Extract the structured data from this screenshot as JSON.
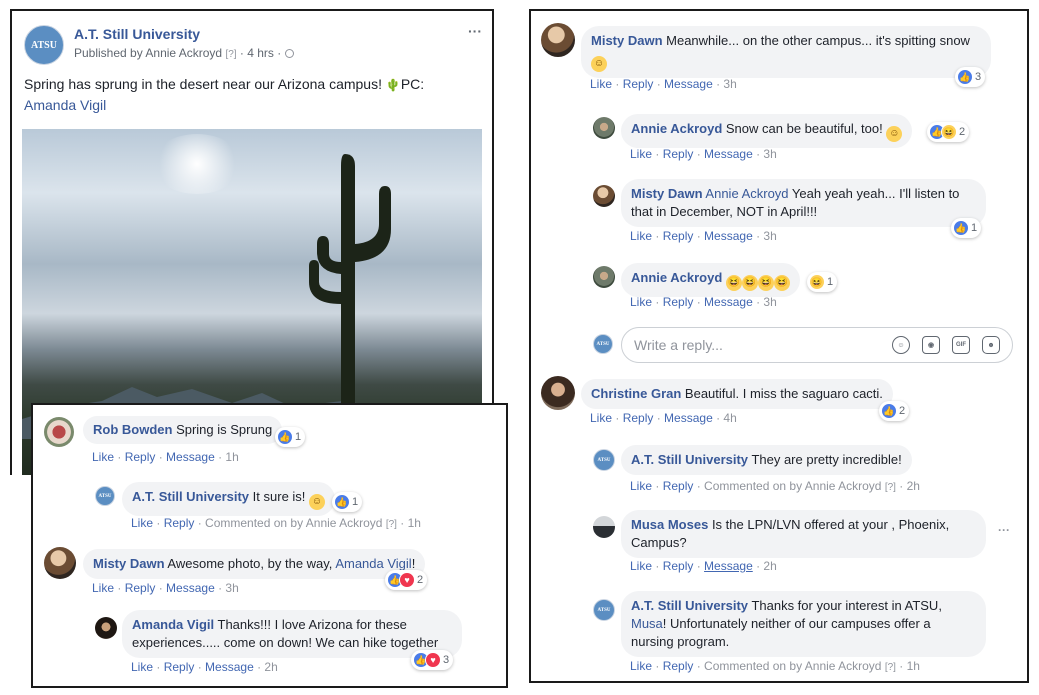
{
  "post": {
    "page_name": "A.T. Still University",
    "meta": "Published by Annie Ackroyd",
    "q": "[?]",
    "time": "· 4 hrs ·",
    "more": "···",
    "text": "Spring has sprung in the desert near our Arizona campus! ",
    "cactus_emoji": "🌵",
    "pc": "PC:",
    "pc_link": "Amanda Vigil",
    "logo_text": "ATSU"
  },
  "labels": {
    "like": "Like",
    "reply": "Reply",
    "message": "Message",
    "commented_by": "Commented on by Annie Ackroyd",
    "q": "[?]"
  },
  "left_comments": [
    {
      "name": "Rob Bowden",
      "text": "Spring is Sprung",
      "react_count": "1",
      "time": "1h"
    },
    {
      "name": "A.T. Still University",
      "text": "It sure is! ",
      "react_count": "1",
      "time": "1h"
    },
    {
      "name": "Misty Dawn",
      "text": "Awesome photo, by the way, ",
      "mention": "Amanda Vigil",
      "text_end": "!",
      "react_count": "2",
      "time": "3h"
    },
    {
      "name": "Amanda Vigil",
      "text": "Thanks!!! I love Arizona for these experiences..... come on down! We can hike together",
      "react_count": "3",
      "time": "2h"
    }
  ],
  "right_comments": [
    {
      "name": "Misty Dawn",
      "text": "Meanwhile... on the other campus... it's spitting snow ",
      "react_count": "3",
      "time": "3h"
    },
    {
      "name": "Annie Ackroyd",
      "text": "Snow can be beautiful, too! ",
      "react_count": "2",
      "time": "3h"
    },
    {
      "name": "Misty Dawn",
      "mention": "Annie Ackroyd",
      "text": " Yeah yeah yeah... I'll listen to that in December, NOT in April!!!",
      "react_count": "1",
      "time": "3h"
    },
    {
      "name": "Annie Ackroyd",
      "text": "",
      "react_count": "1",
      "time": "3h"
    },
    {
      "name": "Christine Gran",
      "text": "Beautiful. I miss the saguaro cacti.",
      "react_count": "2",
      "time": "4h"
    },
    {
      "name": "A.T. Still University",
      "text": "They are pretty incredible!",
      "time": "2h"
    },
    {
      "name": "Musa Moses",
      "text": "Is the LPN/LVN offered at your , Phoenix, Campus?",
      "time": "2h"
    },
    {
      "name": "A.T. Still University",
      "text": "Thanks for your interest in ATSU, ",
      "mention": "Musa",
      "text_end": "! Unfortunately neither of our campuses offer a nursing program.",
      "time": "1h"
    }
  ],
  "reply_box": {
    "placeholder": "Write a reply...",
    "gif": "GIF"
  },
  "emoji": {
    "smile": "☺",
    "laugh": "😆",
    "haha": "😂"
  }
}
